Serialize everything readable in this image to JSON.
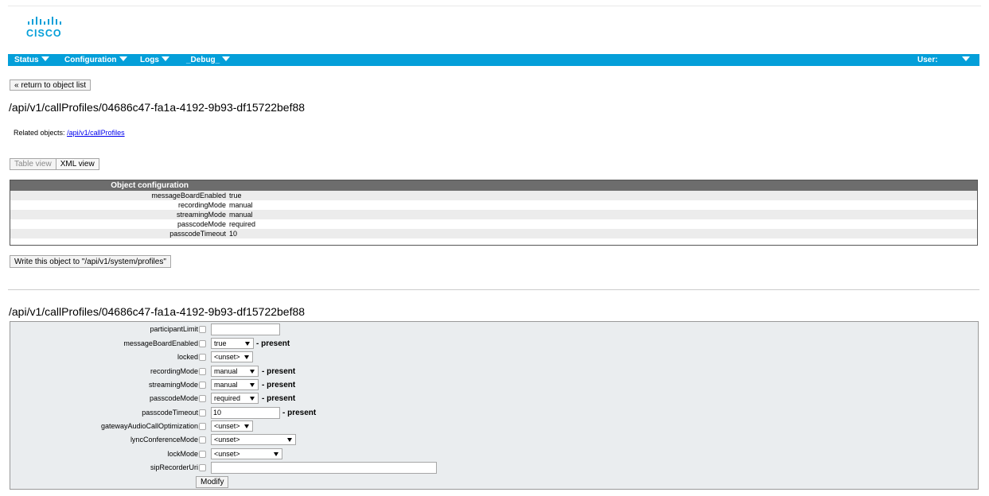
{
  "navbar": {
    "status": "Status",
    "configuration": "Configuration",
    "logs": "Logs",
    "debug": "_Debug_",
    "user": "User:"
  },
  "return_button": "« return to object list",
  "object_title": "/api/v1/callProfiles/04686c47-fa1a-4192-9b93-df15722bef88",
  "related": {
    "label": "Related objects:",
    "link": "/api/v1/callProfiles"
  },
  "view_toggle": {
    "table": "Table view",
    "xml": "XML view"
  },
  "config_table": {
    "header": "Object configuration",
    "rows": [
      {
        "key": "messageBoardEnabled",
        "value": "true"
      },
      {
        "key": "recordingMode",
        "value": "manual"
      },
      {
        "key": "streamingMode",
        "value": "manual"
      },
      {
        "key": "passcodeMode",
        "value": "required"
      },
      {
        "key": "passcodeTimeout",
        "value": "10"
      }
    ]
  },
  "write_button": "Write this object to \"/api/v1/system/profiles\"",
  "form_title": "/api/v1/callProfiles/04686c47-fa1a-4192-9b93-df15722bef88",
  "form": {
    "participantLimit": {
      "label": "participantLimit",
      "value": ""
    },
    "messageBoardEnabled": {
      "label": "messageBoardEnabled",
      "value": "true",
      "status": "- present"
    },
    "locked": {
      "label": "locked",
      "value": "<unset>"
    },
    "recordingMode": {
      "label": "recordingMode",
      "value": "manual",
      "status": "- present"
    },
    "streamingMode": {
      "label": "streamingMode",
      "value": "manual",
      "status": "- present"
    },
    "passcodeMode": {
      "label": "passcodeMode",
      "value": "required",
      "status": "- present"
    },
    "passcodeTimeout": {
      "label": "passcodeTimeout",
      "value": "10",
      "status": "- present"
    },
    "gatewayAudioCallOptimization": {
      "label": "gatewayAudioCallOptimization",
      "value": "<unset>"
    },
    "lyncConferenceMode": {
      "label": "lyncConferenceMode",
      "value": "<unset>"
    },
    "lockMode": {
      "label": "lockMode",
      "value": "<unset>"
    },
    "sipRecorderUri": {
      "label": "sipRecorderUri",
      "value": ""
    },
    "modify_button": "Modify"
  },
  "colors": {
    "nav": "#049fd9",
    "cisco_logo": "#049fd9",
    "table_header": "#6d6d6d",
    "form_bg": "#eaedef"
  },
  "logo_text": "CISCO"
}
